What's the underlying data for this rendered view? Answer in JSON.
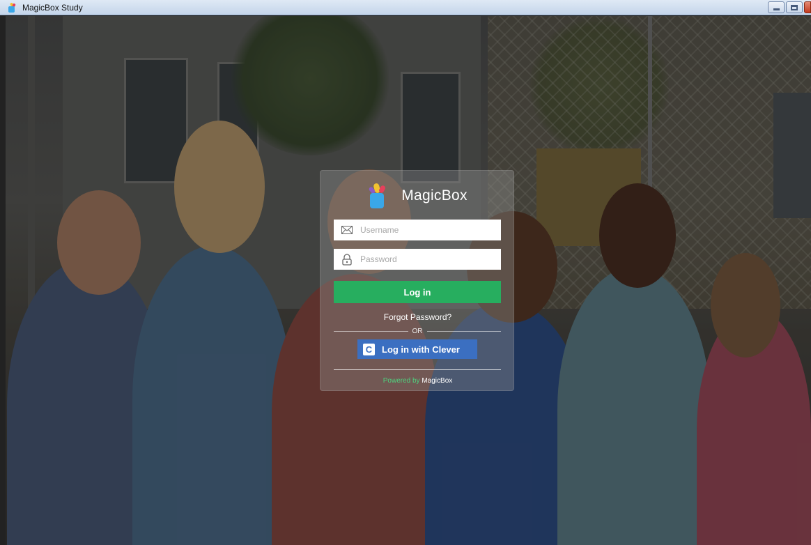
{
  "window": {
    "title": "MagicBox Study",
    "icon": "magicbox-app-icon"
  },
  "login": {
    "brand": "MagicBox",
    "username_placeholder": "Username",
    "password_placeholder": "Password",
    "username_icon": "envelope-icon",
    "password_icon": "lock-icon",
    "login_label": "Log in",
    "forgot_label": "Forgot Password?",
    "or_label": "OR",
    "clever_label": "Log in with Clever",
    "clever_icon": "clever-c-icon",
    "powered_prefix": "Powered by",
    "powered_brand": "MagicBox"
  },
  "colors": {
    "login_button": "#27ae5f",
    "clever_button": "#3b6fc1",
    "powered_by": "#4fd17e",
    "logo_blue": "#3aa7e8"
  }
}
